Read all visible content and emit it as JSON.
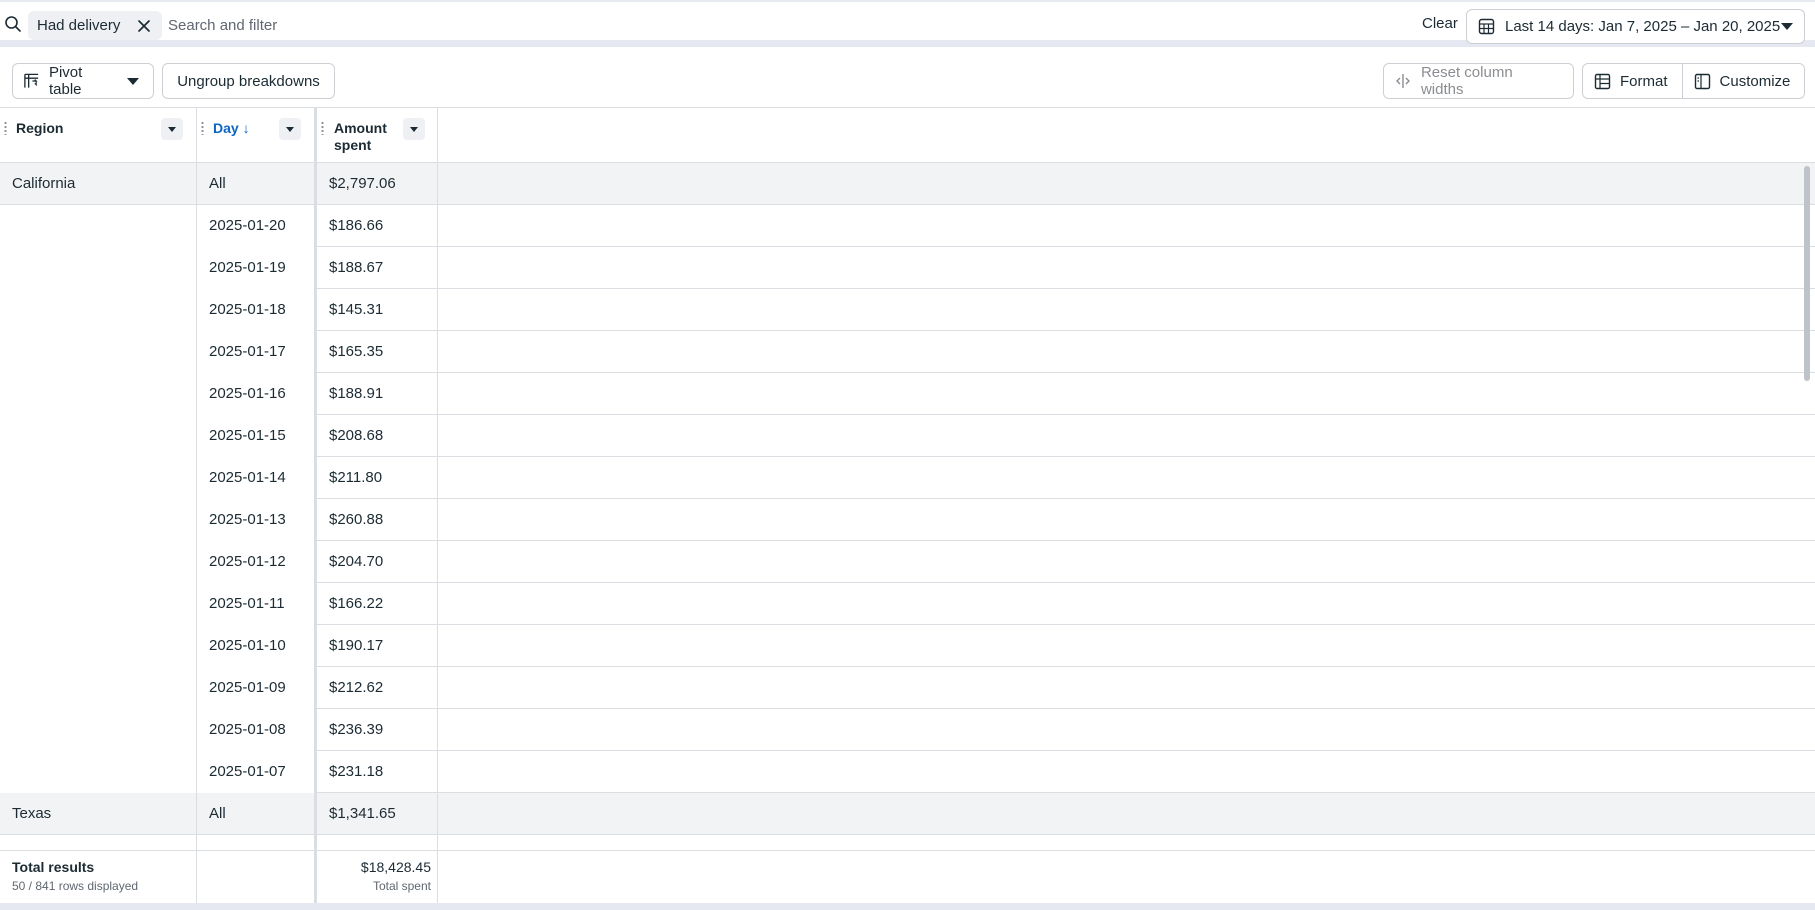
{
  "filter": {
    "chip_label": "Had delivery",
    "search_placeholder": "Search and filter",
    "clear_label": "Clear",
    "date_range_label": "Last 14 days: Jan 7, 2025 – Jan 20, 2025"
  },
  "toolbar": {
    "pivot_label": "Pivot table",
    "ungroup_label": "Ungroup breakdowns",
    "reset_label": "Reset column widths",
    "format_label": "Format",
    "customize_label": "Customize"
  },
  "table": {
    "headers": {
      "region": "Region",
      "day": "Day ↓",
      "amount_line1": "Amount",
      "amount_line2": "spent"
    },
    "groups": [
      {
        "region": "California",
        "total_label": "All",
        "total_amount": "$2,797.06",
        "rows": [
          {
            "day": "2025-01-20",
            "amount": "$186.66"
          },
          {
            "day": "2025-01-19",
            "amount": "$188.67"
          },
          {
            "day": "2025-01-18",
            "amount": "$145.31"
          },
          {
            "day": "2025-01-17",
            "amount": "$165.35"
          },
          {
            "day": "2025-01-16",
            "amount": "$188.91"
          },
          {
            "day": "2025-01-15",
            "amount": "$208.68"
          },
          {
            "day": "2025-01-14",
            "amount": "$211.80"
          },
          {
            "day": "2025-01-13",
            "amount": "$260.88"
          },
          {
            "day": "2025-01-12",
            "amount": "$204.70"
          },
          {
            "day": "2025-01-11",
            "amount": "$166.22"
          },
          {
            "day": "2025-01-10",
            "amount": "$190.17"
          },
          {
            "day": "2025-01-09",
            "amount": "$212.62"
          },
          {
            "day": "2025-01-08",
            "amount": "$236.39"
          },
          {
            "day": "2025-01-07",
            "amount": "$231.18"
          }
        ]
      },
      {
        "region": "Texas",
        "total_label": "All",
        "total_amount": "$1,341.65",
        "rows": []
      }
    ]
  },
  "footer": {
    "title": "Total results",
    "rows_displayed": "50 / 841 rows displayed",
    "total_value": "$18,428.45",
    "total_label": "Total spent"
  }
}
